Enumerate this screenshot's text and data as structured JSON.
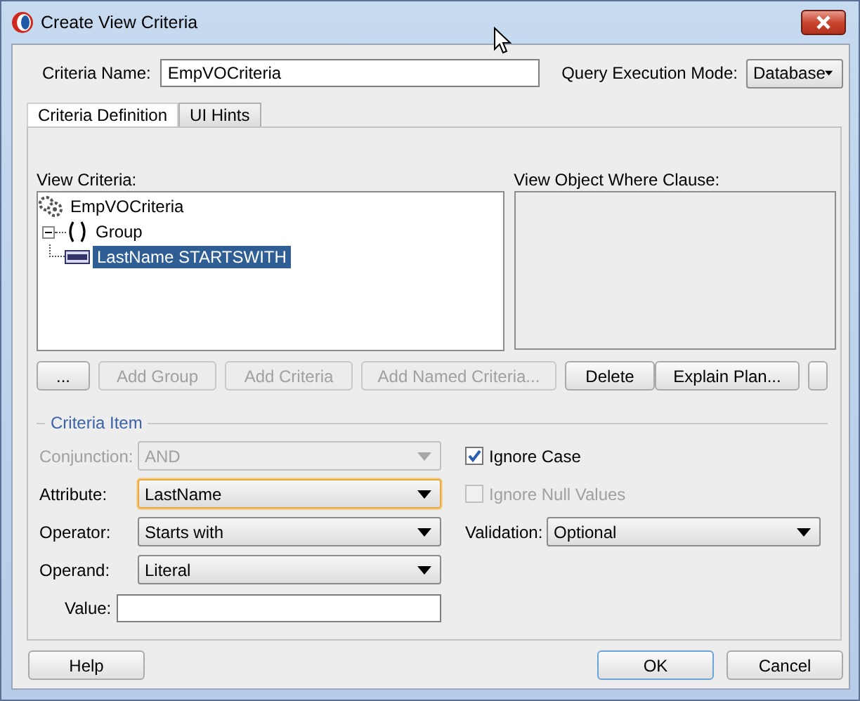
{
  "window": {
    "title": "Create View Criteria"
  },
  "criteria_name": {
    "label": "Criteria Name:",
    "value": "EmpVOCriteria"
  },
  "query_execution_mode": {
    "label": "Query Execution Mode:",
    "value": "Database"
  },
  "tabs": [
    {
      "label": "Criteria Definition",
      "selected": true
    },
    {
      "label": "UI Hints",
      "selected": false
    }
  ],
  "view_criteria": {
    "label": "View Criteria:",
    "tree": [
      {
        "label": "EmpVOCriteria",
        "kind": "criteria",
        "selected": false,
        "children": [
          {
            "label": "Group",
            "kind": "group",
            "expanded": true,
            "selected": false,
            "children": [
              {
                "label": "LastName STARTSWITH",
                "kind": "item",
                "selected": true
              }
            ]
          }
        ]
      }
    ]
  },
  "where_clause": {
    "label": "View Object Where Clause:"
  },
  "toolbar": [
    {
      "label": "...",
      "disabled": false
    },
    {
      "label": "Add Group",
      "disabled": true
    },
    {
      "label": "Add Criteria",
      "disabled": true
    },
    {
      "label": "Add Named Criteria...",
      "disabled": true
    },
    {
      "label": "Delete",
      "disabled": false
    },
    {
      "label": "Explain Plan...",
      "disabled": false
    }
  ],
  "criteria_item": {
    "title": "Criteria Item",
    "fields": [
      {
        "label": "Conjunction:",
        "kind": "select",
        "value": "AND",
        "disabled": true,
        "focused": false
      },
      {
        "label": "Attribute:",
        "kind": "select",
        "value": "LastName",
        "disabled": false,
        "focused": true
      },
      {
        "label": "Operator:",
        "kind": "select",
        "value": "Starts with",
        "disabled": false,
        "focused": false
      },
      {
        "label": "Operand:",
        "kind": "select",
        "value": "Literal",
        "disabled": false,
        "focused": false
      },
      {
        "label": "Value:",
        "kind": "text",
        "disabled": false,
        "focused": false
      }
    ],
    "checkboxes": [
      {
        "label": "Ignore Case",
        "checked": true,
        "disabled": false
      },
      {
        "label": "Ignore Null Values",
        "checked": false,
        "disabled": true
      }
    ],
    "validation": {
      "label": "Validation:",
      "value": "Optional"
    }
  },
  "buttons": [
    {
      "label": "Help",
      "default": false
    },
    {
      "label": "OK",
      "default": true
    },
    {
      "label": "Cancel",
      "default": false
    }
  ]
}
